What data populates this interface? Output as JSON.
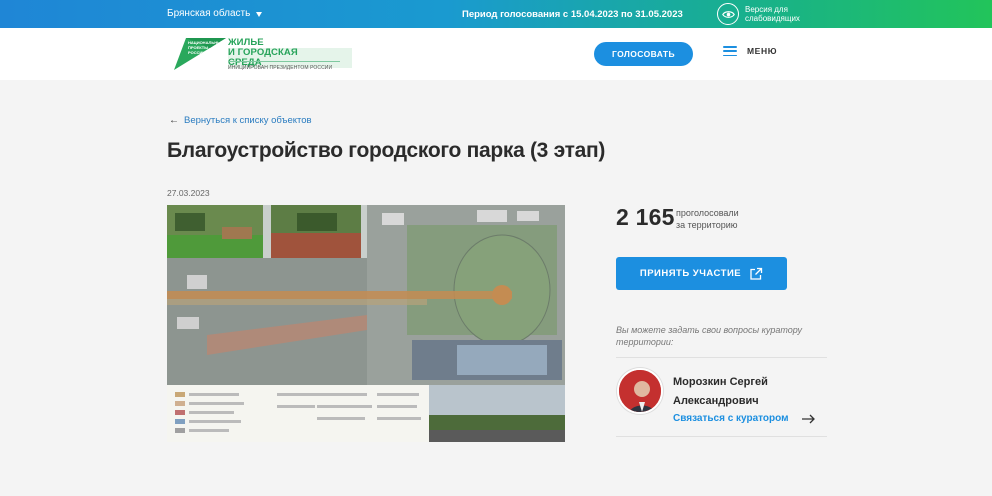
{
  "topbar": {
    "region": "Брянская область",
    "period": "Период голосования с 15.04.2023 по 31.05.2023",
    "vision_line1": "Версия для",
    "vision_line2": "слабовидящих",
    "icon": "eye-icon"
  },
  "header": {
    "logo_small": "НАЦИОНАЛЬНЫЕ ПРОЕКТЫ РОССИИ",
    "logo_title_1": "ЖИЛЬЕ",
    "logo_title_2": "И ГОРОДСКАЯ СРЕДА",
    "logo_sub": "ИНИЦИИРОВАН ПРЕЗИДЕНТОМ РОССИИ",
    "vote_label": "ГОЛОСОВАТЬ",
    "menu_label": "МЕНЮ",
    "accent": "#1c8fe0",
    "brand_green": "#27a35a"
  },
  "content": {
    "back_label": "Вернуться к списку объектов",
    "title": "Благоустройство городского парка (3 этап)",
    "date": "27.03.2023"
  },
  "sidebar": {
    "count": "2 165",
    "count_label_1": "проголосовали",
    "count_label_2": "за территорию",
    "take_part_label": "ПРИНЯТЬ УЧАСТИЕ",
    "question": "Вы можете задать свои вопросы куратору территории:",
    "curator_name_1": "Морозкин Сергей",
    "curator_name_2": "Александрович",
    "contact_label": "Связаться с куратором"
  }
}
